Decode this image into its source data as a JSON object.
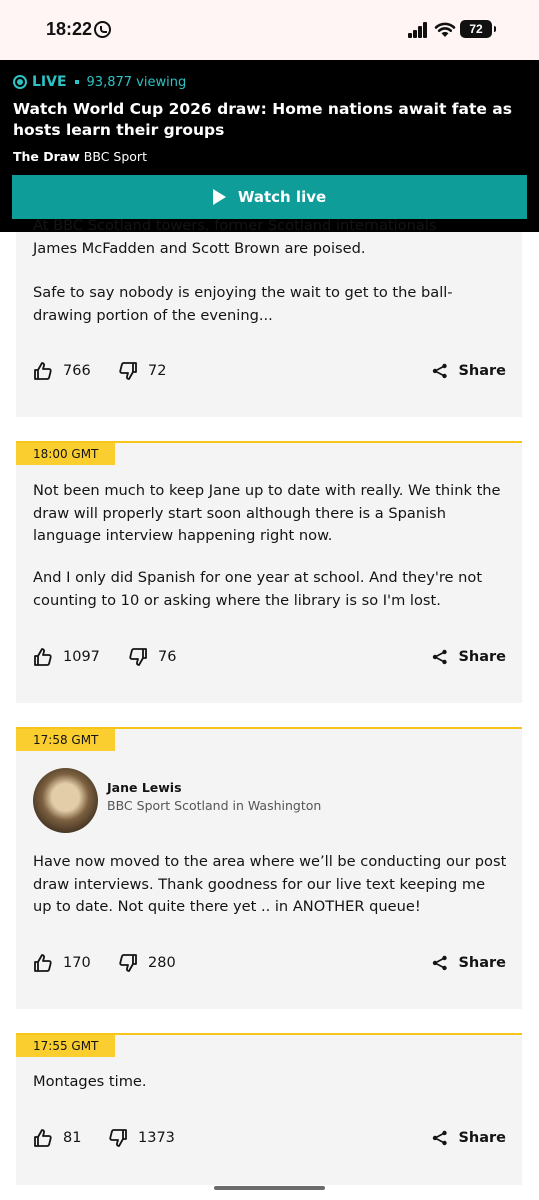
{
  "status_bar": {
    "time": "18:22",
    "battery": "72"
  },
  "live_banner": {
    "live_label": "LIVE",
    "viewing": "93,877 viewing",
    "title": "Watch World Cup 2026 draw: Home nations await fate as hosts learn their groups",
    "source_bold": "The Draw",
    "source": "BBC Sport",
    "watch_label": "Watch live"
  },
  "posts": [
    {
      "time": "",
      "partial_line": "At BBC Scotland towers, former Scotland internationals",
      "paragraphs": [
        "James McFadden and Scott Brown are poised.",
        "Safe to say nobody is enjoying the wait to get to the ball-drawing portion of the evening..."
      ],
      "likes": "766",
      "dislikes": "72",
      "share_label": "Share"
    },
    {
      "time": "18:00 GMT",
      "paragraphs": [
        "Not been much to keep Jane up to date with really. We think the draw will properly start soon although there is a Spanish language interview happening right now.",
        "And I only did Spanish for one year at school. And they're not counting to 10 or asking where the library is so I'm lost."
      ],
      "likes": "1097",
      "dislikes": "76",
      "share_label": "Share"
    },
    {
      "time": "17:58 GMT",
      "author": {
        "name": "Jane Lewis",
        "role": "BBC Sport Scotland in Washington"
      },
      "paragraphs": [
        "Have now moved to the area where we’ll be conducting our post draw interviews. Thank goodness for our live text keeping me up to date. Not quite there yet .. in ANOTHER queue!"
      ],
      "likes": "170",
      "dislikes": "280",
      "share_label": "Share"
    },
    {
      "time": "17:55 GMT",
      "paragraphs": [
        "Montages time."
      ],
      "likes": "81",
      "dislikes": "1373",
      "share_label": "Share"
    }
  ],
  "colors": {
    "live_accent": "#2cc3c5",
    "watch_button": "#0e9d99",
    "time_badge": "#fbce2f"
  },
  "icons": [
    "whatsapp-icon",
    "signal-icon",
    "wifi-icon",
    "battery-icon",
    "live-icon",
    "play-icon",
    "thumbs-up-icon",
    "thumbs-down-icon",
    "share-icon"
  ]
}
